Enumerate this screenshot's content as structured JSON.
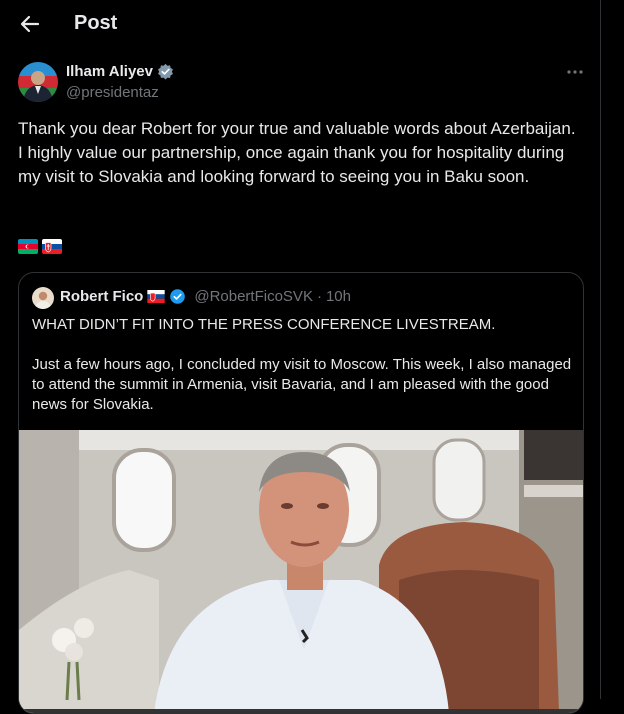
{
  "header": {
    "title": "Post",
    "back_icon": "arrow-left-icon"
  },
  "tweet": {
    "author_name": "Ilham Aliyev",
    "author_handle": "@presidentaz",
    "verified_icon": "verified-badge-icon",
    "more_icon": "more-horizontal-icon",
    "text": "Thank you dear Robert for your true and valuable words about Azerbaijan. I highly value our partnership, once again thank you for hospitality during my visit to Slovakia and looking forward to seeing you in Baku soon.",
    "flags": [
      "azerbaijan-flag-icon",
      "slovakia-flag-icon"
    ]
  },
  "quoted": {
    "author_name": "Robert Fico",
    "author_flag": "slovakia-flag-icon",
    "verified_icon": "verified-badge-icon",
    "handle": "@RobertFicoSVK",
    "separator": "·",
    "time": "10h",
    "text_line1": "WHAT DIDN’T FIT INTO THE PRESS CONFERENCE LIVESTREAM.",
    "text_line2": "Just a few hours ago, I concluded my visit to Moscow. This week, I also managed to attend the summit in Armenia, visit Bavaria, and I am pleased with the good news for Slovakia."
  },
  "colors": {
    "background": "#000000",
    "text": "#e7e9ea",
    "muted": "#71767b",
    "border": "#2f3336",
    "verified": "#1d9bf0"
  }
}
